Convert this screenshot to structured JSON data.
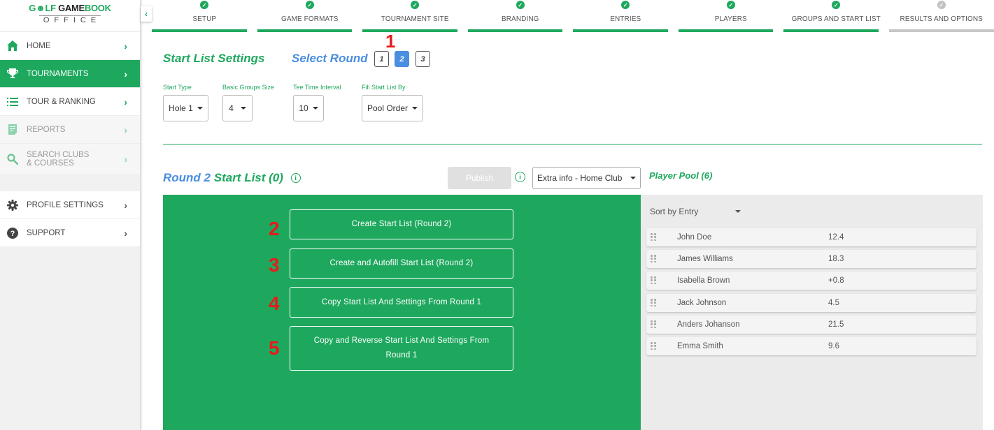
{
  "logo": {
    "brand_green_1": "G",
    "brand_icon": "golfer-icon",
    "brand_green_2": "LF ",
    "brand_dark": "GAME",
    "brand_green_3": "BOOK",
    "sub": "OFFICE"
  },
  "sidebar": {
    "items": [
      {
        "label": "HOME",
        "icon": "home-icon",
        "state": "normal"
      },
      {
        "label": "TOURNAMENTS",
        "icon": "trophy-icon",
        "state": "active"
      },
      {
        "label": "TOUR & RANKING",
        "icon": "ranked-list-icon",
        "state": "normal"
      },
      {
        "label": "REPORTS",
        "icon": "report-icon",
        "state": "disabled"
      },
      {
        "label": "SEARCH CLUBS & COURSES",
        "icon": "search-icon",
        "state": "disabled"
      },
      {
        "label": "PROFILE SETTINGS",
        "icon": "gear-icon",
        "state": "normal"
      },
      {
        "label": "SUPPORT",
        "icon": "help-icon",
        "state": "normal"
      }
    ],
    "collapse_glyph": "‹"
  },
  "steps": [
    {
      "label": "SETUP",
      "done": true
    },
    {
      "label": "GAME FORMATS",
      "done": true
    },
    {
      "label": "TOURNAMENT SITE",
      "done": true
    },
    {
      "label": "BRANDING",
      "done": true
    },
    {
      "label": "ENTRIES",
      "done": true
    },
    {
      "label": "PLAYERS",
      "done": true
    },
    {
      "label": "GROUPS AND START LIST",
      "done": true
    },
    {
      "label": "RESULTS AND OPTIONS",
      "done": false
    }
  ],
  "settings": {
    "title": "Start List Settings",
    "select_round_label": "Select Round",
    "rounds": [
      "1",
      "2",
      "3"
    ],
    "selected_round": "2",
    "fields": [
      {
        "label": "Start Type",
        "value": "Hole 1"
      },
      {
        "label": "Basic Groups Size",
        "value": "4"
      },
      {
        "label": "Tee Time Interval",
        "value": "10"
      },
      {
        "label": "Fill Start List By",
        "value": "Pool Order"
      }
    ]
  },
  "startlist": {
    "round_label": "Round 2",
    "title": "Start List (0)",
    "info_glyph": "i",
    "publish_label": "Publish",
    "extra_info_value": "Extra info - Home Club",
    "actions": [
      {
        "label": "Create Start List (Round 2)"
      },
      {
        "label": "Create and Autofill Start List (Round 2)"
      },
      {
        "label": "Copy Start List And Settings From Round 1"
      },
      {
        "label": "Copy and Reverse Start List And Settings From Round 1"
      }
    ]
  },
  "pool": {
    "title": "Player Pool (6)",
    "sort_value": "Sort by Entry",
    "players": [
      {
        "name": "John Doe",
        "hcp": "12.4"
      },
      {
        "name": "James Williams",
        "hcp": "18.3"
      },
      {
        "name": "Isabella Brown",
        "hcp": "+0.8"
      },
      {
        "name": "Jack Johnson",
        "hcp": "4.5"
      },
      {
        "name": "Anders Johanson",
        "hcp": "21.5"
      },
      {
        "name": "Emma Smith",
        "hcp": "9.6"
      }
    ]
  },
  "annotations": [
    "1",
    "2",
    "3",
    "4",
    "5"
  ],
  "colors": {
    "brand_green": "#1ea85e",
    "accent_blue": "#4a8ee0",
    "annotation_red": "#e61b1b",
    "pending_gray": "#c6c6c6"
  }
}
